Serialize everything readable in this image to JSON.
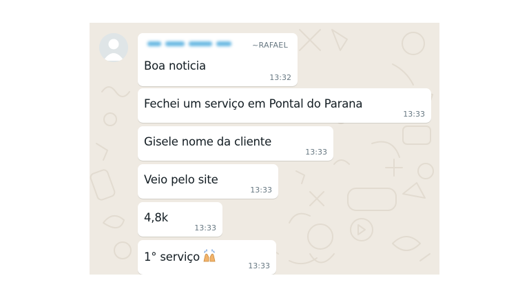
{
  "chat": {
    "sender": {
      "name": "~RAFAEL",
      "avatar_icon": "default-user-avatar-icon",
      "phone_blurred": true
    },
    "messages": [
      {
        "text": "Boa noticia",
        "time": "13:32"
      },
      {
        "text": "Fechei um serviço em Pontal do Parana",
        "time": "13:33"
      },
      {
        "text": "Gisele nome da cliente",
        "time": "13:33"
      },
      {
        "text": "Veio pelo site",
        "time": "13:33"
      },
      {
        "text": "4,8k",
        "time": "13:33"
      },
      {
        "text": "1° serviço",
        "time": "13:33",
        "emoji": "raising-hands-emoji"
      }
    ],
    "colors": {
      "background": "#efeae2",
      "bubble": "#ffffff",
      "text": "#111b21",
      "meta": "#667781"
    }
  }
}
